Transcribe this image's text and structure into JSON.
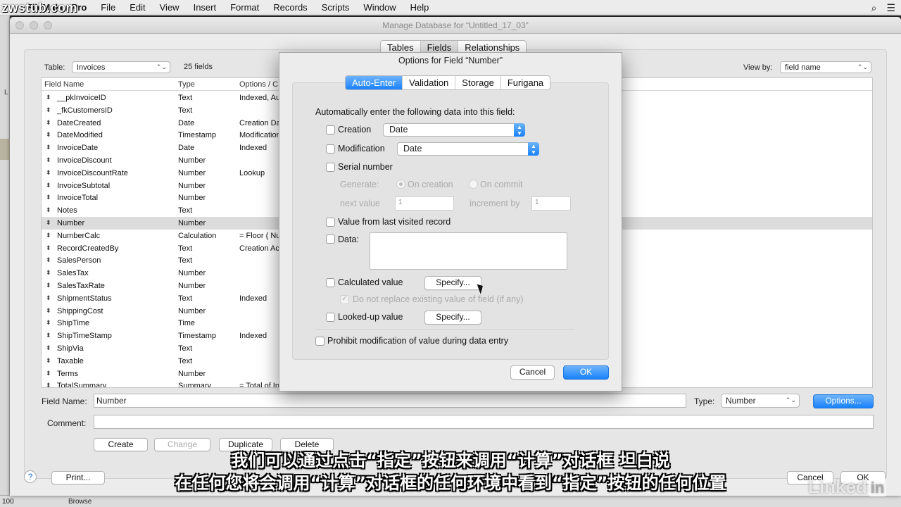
{
  "watermark": "zwstub.com",
  "menubar": {
    "apple": "",
    "app": "FileMaker Pro",
    "items": [
      "File",
      "Edit",
      "View",
      "Insert",
      "Format",
      "Records",
      "Scripts",
      "Window",
      "Help"
    ]
  },
  "background": {
    "left_label": "L",
    "zoom": "100",
    "mode": "Browse"
  },
  "window": {
    "title": "Manage Database for “Untitled_17_03”",
    "tabs": [
      "Tables",
      "Fields",
      "Relationships"
    ],
    "selected_tab": "Fields",
    "table_label": "Table:",
    "table_value": "Invoices",
    "field_count": "25 fields",
    "viewby_label": "View by:",
    "viewby_value": "field name",
    "columns": [
      "Field Name",
      "Type",
      "Options / C"
    ],
    "fields": [
      {
        "name": "__pkInvoiceID",
        "type": "Text",
        "options": "Indexed, Au"
      },
      {
        "name": "_fkCustomersID",
        "type": "Text",
        "options": ""
      },
      {
        "name": "DateCreated",
        "type": "Date",
        "options": "Creation Da"
      },
      {
        "name": "DateModified",
        "type": "Timestamp",
        "options": "Modification"
      },
      {
        "name": "InvoiceDate",
        "type": "Date",
        "options": "Indexed"
      },
      {
        "name": "InvoiceDiscount",
        "type": "Number",
        "options": ""
      },
      {
        "name": "InvoiceDiscountRate",
        "type": "Number",
        "options": "Lookup"
      },
      {
        "name": "InvoiceSubtotal",
        "type": "Number",
        "options": ""
      },
      {
        "name": "InvoiceTotal",
        "type": "Number",
        "options": ""
      },
      {
        "name": "Notes",
        "type": "Text",
        "options": ""
      },
      {
        "name": "Number",
        "type": "Number",
        "options": ""
      },
      {
        "name": "NumberCalc",
        "type": "Calculation",
        "options": "= Floor ( Nu"
      },
      {
        "name": "RecordCreatedBy",
        "type": "Text",
        "options": "Creation Ac"
      },
      {
        "name": "SalesPerson",
        "type": "Text",
        "options": ""
      },
      {
        "name": "SalesTax",
        "type": "Number",
        "options": ""
      },
      {
        "name": "SalesTaxRate",
        "type": "Number",
        "options": ""
      },
      {
        "name": "ShipmentStatus",
        "type": "Text",
        "options": "Indexed"
      },
      {
        "name": "ShippingCost",
        "type": "Number",
        "options": ""
      },
      {
        "name": "ShipTime",
        "type": "Time",
        "options": ""
      },
      {
        "name": "ShipTimeStamp",
        "type": "Timestamp",
        "options": "Indexed"
      },
      {
        "name": "ShipVia",
        "type": "Text",
        "options": ""
      },
      {
        "name": "Taxable",
        "type": "Text",
        "options": ""
      },
      {
        "name": "Terms",
        "type": "Number",
        "options": ""
      },
      {
        "name": "TotalSummary",
        "type": "Summary",
        "options": "= Total of In"
      }
    ],
    "selected_field": "Number",
    "fieldname_label": "Field Name:",
    "fieldname_value": "Number",
    "type_label": "Type:",
    "type_value": "Number",
    "options_button": "Options...",
    "comment_label": "Comment:",
    "create_button": "Create",
    "change_button": "Change",
    "duplicate_button": "Duplicate",
    "delete_button": "Delete",
    "help_button": "?",
    "print_button": "Print...",
    "cancel_button": "Cancel",
    "ok_button": "OK"
  },
  "dialog": {
    "title": "Options for Field “Number”",
    "tabs": [
      "Auto-Enter",
      "Validation",
      "Storage",
      "Furigana"
    ],
    "active_tab": "Auto-Enter",
    "heading": "Automatically enter the following data into this field:",
    "creation_label": "Creation",
    "creation_value": "Date",
    "modification_label": "Modification",
    "modification_value": "Date",
    "serial_label": "Serial number",
    "generate_label": "Generate:",
    "on_creation": "On creation",
    "on_commit": "On commit",
    "next_value_label": "next value",
    "next_value": "1",
    "increment_label": "increment by",
    "increment_value": "1",
    "last_visited": "Value from last visited record",
    "data_label": "Data:",
    "calc_label": "Calculated value",
    "calc_specify": "Specify...",
    "do_not_replace": "Do not replace existing value of field (if any)",
    "lookup_label": "Looked-up value",
    "lookup_specify": "Specify...",
    "prohibit": "Prohibit modification of value during data entry",
    "cancel_button": "Cancel",
    "ok_button": "OK"
  },
  "subtitles": {
    "line1": "我们可以通过点击“指定”按钮来调用“计算”对话框  坦白说",
    "line2": "在任何您将会调用“计算”对话框的任何环境中看到“指定”按钮的任何位置"
  },
  "brand": {
    "text": "Linked",
    "in": "in"
  },
  "colors": {
    "accent": "#1a82fb",
    "selected_row": "#dcdcdc"
  }
}
